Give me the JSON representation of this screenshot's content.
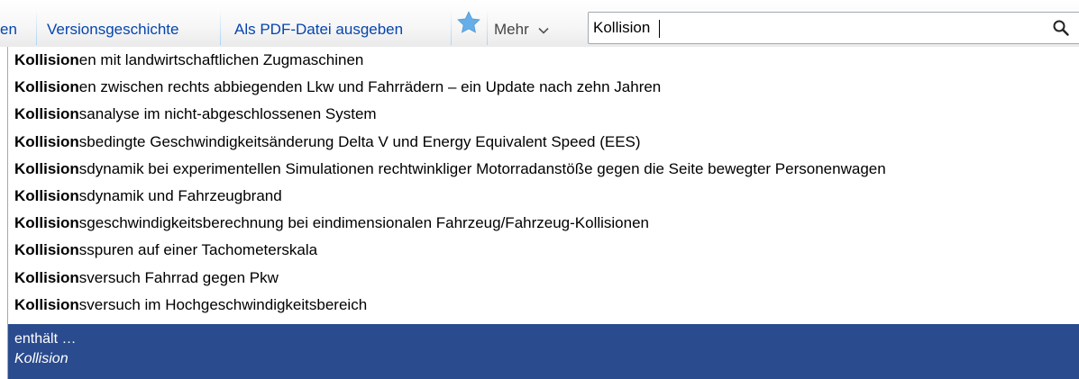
{
  "tabs": {
    "partial_label": "en",
    "history_label": "Versionsgeschichte",
    "pdf_label": "Als PDF-Datei ausgeben",
    "more_label": "Mehr"
  },
  "search": {
    "value": "Kollision"
  },
  "suggestions": [
    {
      "bold": "Kollision",
      "rest": "en mit landwirtschaftlichen Zugmaschinen"
    },
    {
      "bold": "Kollision",
      "rest": "en zwischen rechts abbiegenden Lkw und Fahrrädern – ein Update nach zehn Jahren"
    },
    {
      "bold": "Kollision",
      "rest": "sanalyse im nicht-abgeschlossenen System"
    },
    {
      "bold": "Kollision",
      "rest": "sbedingte Geschwindigkeitsänderung Delta V und Energy Equivalent Speed (EES)"
    },
    {
      "bold": "Kollision",
      "rest": "sdynamik bei experimentellen Simulationen rechtwinkliger Motorradanstöße gegen die Seite bewegter Personenwagen"
    },
    {
      "bold": "Kollision",
      "rest": "sdynamik und Fahrzeugbrand"
    },
    {
      "bold": "Kollision",
      "rest": "sgeschwindigkeitsberechnung bei eindimensionalen Fahrzeug/Fahrzeug-Kollisionen"
    },
    {
      "bold": "Kollision",
      "rest": "sspuren auf einer Tachometerskala"
    },
    {
      "bold": "Kollision",
      "rest": "sversuch Fahrrad gegen Pkw"
    },
    {
      "bold": "Kollision",
      "rest": "sversuch im Hochgeschwindigkeitsbereich"
    }
  ],
  "special": {
    "label": "enthält …",
    "term": "Kollision"
  },
  "colors": {
    "link": "#0645ad",
    "star": "#66aee8",
    "highlight_bg": "#2a4b8d",
    "border": "#a2a9b1"
  },
  "icons": {
    "star": "star-icon",
    "chevron": "chevron-down-icon",
    "search": "search-icon"
  }
}
